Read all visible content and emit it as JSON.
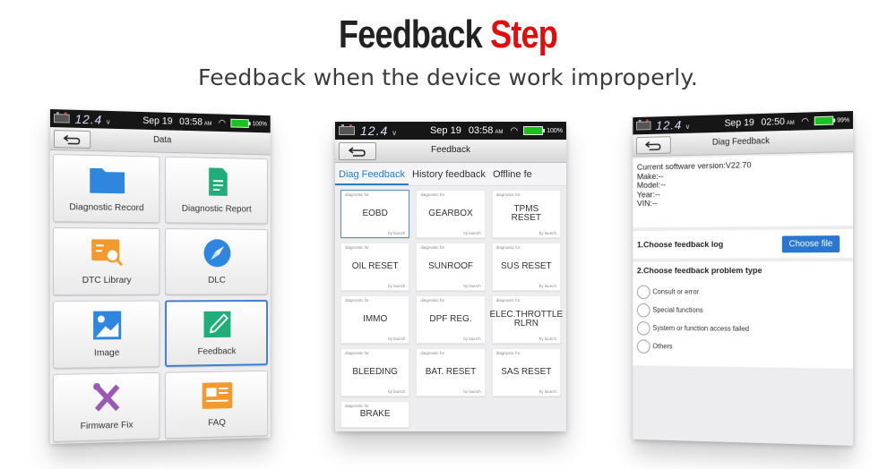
{
  "headline": {
    "part1": "Feedback",
    "part2": "Step"
  },
  "subheadline": "Feedback when the device work improperly.",
  "colors": {
    "accent_red": "#e30b0b",
    "accent_blue": "#2a77d2",
    "battery_green": "#18c418"
  },
  "screens": [
    {
      "status": {
        "voltage": "12.4",
        "voltage_unit": "v",
        "date": "Sep 19",
        "time": "03:58",
        "ampm": "AM",
        "battery": "100%"
      },
      "title": "Data",
      "back_icon": "back-arrow-icon",
      "tiles": [
        {
          "label": "Diagnostic Record",
          "icon": "folder-icon",
          "color": "#2e86de"
        },
        {
          "label": "Diagnostic Report",
          "icon": "document-icon",
          "color": "#1fae7a"
        },
        {
          "label": "DTC Library",
          "icon": "search-list-icon",
          "color": "#f39a2e"
        },
        {
          "label": "DLC",
          "icon": "compass-icon",
          "color": "#2e86de"
        },
        {
          "label": "Image",
          "icon": "image-icon",
          "color": "#2e86de"
        },
        {
          "label": "Feedback",
          "icon": "pencil-icon",
          "color": "#1fae7a",
          "selected": true
        },
        {
          "label": "Firmware Fix",
          "icon": "tools-icon",
          "color": "#9b59b6"
        },
        {
          "label": "FAQ",
          "icon": "faq-icon",
          "color": "#f39a2e"
        }
      ]
    },
    {
      "status": {
        "voltage": "12.4",
        "voltage_unit": "v",
        "date": "Sep 19",
        "time": "03:58",
        "ampm": "AM",
        "battery": "100%"
      },
      "title": "Feedback",
      "tabs": [
        {
          "label": "Diag Feedback",
          "active": true
        },
        {
          "label": "History feedback",
          "active": false
        },
        {
          "label": "Offline fe",
          "active": false
        }
      ],
      "tile_caption": "diagnostic for",
      "tile_footer": "by launch",
      "tiles": [
        "EOBD",
        "GEARBOX",
        "TPMS RESET",
        "OIL RESET",
        "SUNROOF",
        "SUS RESET",
        "IMMO",
        "DPF REG.",
        "ELEC.THROTTLE RLRN",
        "BLEEDING",
        "BAT. RESET",
        "SAS RESET",
        "BRAKE"
      ]
    },
    {
      "status": {
        "voltage": "12.4",
        "voltage_unit": "v",
        "date": "Sep 19",
        "time": "02:50",
        "ampm": "AM",
        "battery": "99%"
      },
      "title": "Diag Feedback",
      "info": {
        "software_version": "Current software version:V22.70",
        "make": "Make:--",
        "model": "Model:--",
        "year": "Year:--",
        "vin": "VIN:--"
      },
      "step1": {
        "label": "1.Choose feedback log",
        "button": "Choose file"
      },
      "step2": {
        "label": "2.Choose feedback problem type",
        "options": [
          "Consult or error",
          "Special functions",
          "System or function access failed",
          "Others"
        ]
      }
    }
  ]
}
